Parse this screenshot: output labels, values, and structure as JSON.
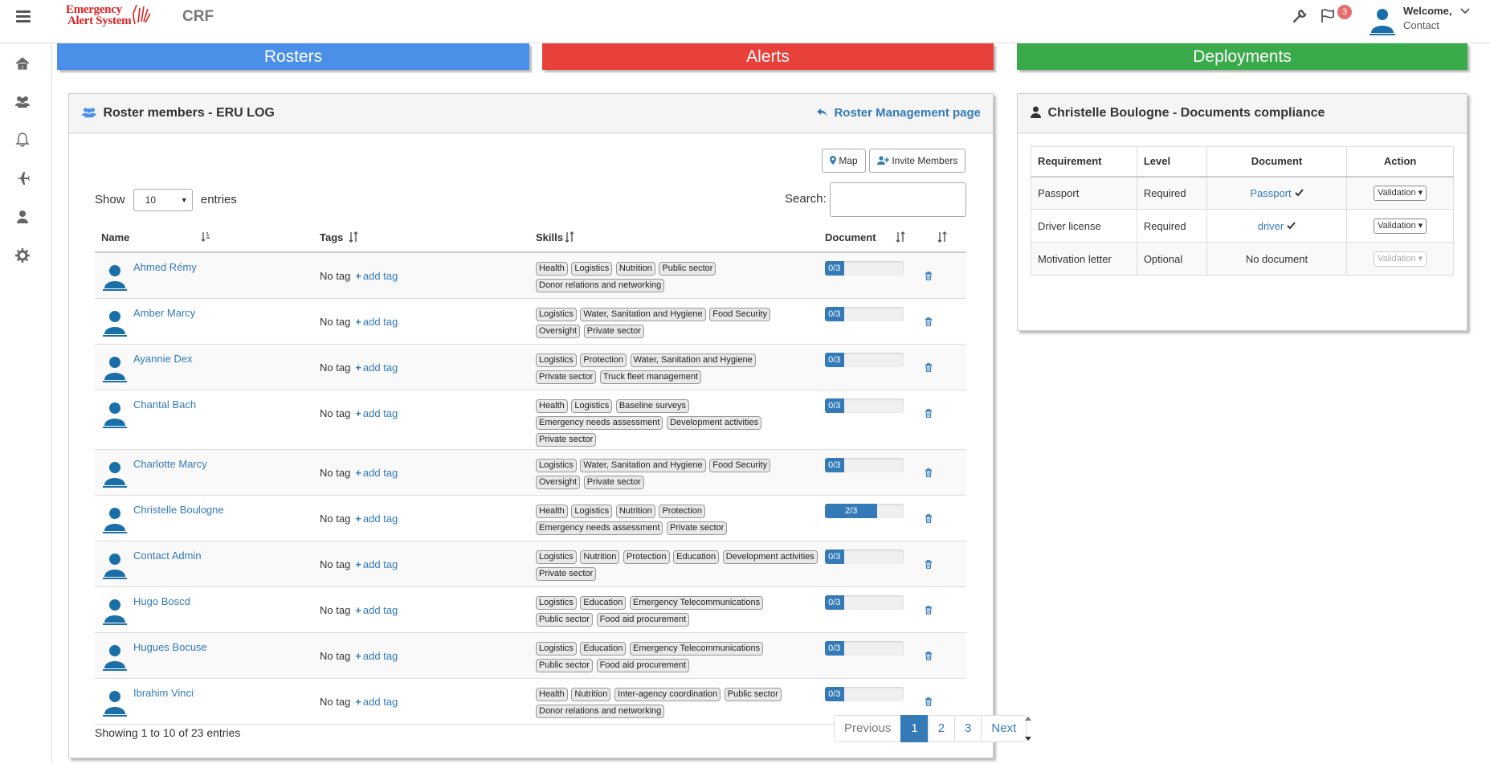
{
  "header": {
    "logo_line1": "Emergency",
    "logo_line2": "Alert System",
    "org": "CRF",
    "notification_count": "3",
    "welcome": "Welcome,",
    "user_name": "Contact"
  },
  "tabs": [
    "Rosters",
    "Alerts",
    "Deployments"
  ],
  "roster": {
    "title": "Roster members - ERU LOG",
    "management_link": "Roster Management page",
    "map_button": "Map",
    "invite_button": "Invite Members",
    "show_label": "Show",
    "entries_value": "10",
    "entries_label": "entries",
    "search_label": "Search:",
    "columns": [
      "Name",
      "Tags",
      "Skills",
      "Document",
      ""
    ],
    "no_tag": "No tag",
    "add_tag": "add tag",
    "members": [
      {
        "name": "Ahmed Rémy",
        "skills": [
          "Health",
          "Logistics",
          "Nutrition",
          "Public sector",
          "Donor relations and networking"
        ],
        "doc": "0/3",
        "doc_fraction": 0
      },
      {
        "name": "Amber Marcy",
        "skills": [
          "Logistics",
          "Water, Sanitation and Hygiene",
          "Food Security",
          "Oversight",
          "Private sector"
        ],
        "doc": "0/3",
        "doc_fraction": 0
      },
      {
        "name": "Ayannie Dex",
        "skills": [
          "Logistics",
          "Protection",
          "Water, Sanitation and Hygiene",
          "Private sector",
          "Truck fleet management"
        ],
        "doc": "0/3",
        "doc_fraction": 0
      },
      {
        "name": "Chantal Bach",
        "skills": [
          "Health",
          "Logistics",
          "Baseline surveys",
          "Emergency needs assessment",
          "Development activities",
          "Private sector"
        ],
        "doc": "0/3",
        "doc_fraction": 0
      },
      {
        "name": "Charlotte Marcy",
        "skills": [
          "Logistics",
          "Water, Sanitation and Hygiene",
          "Food Security",
          "Oversight",
          "Private sector"
        ],
        "doc": "0/3",
        "doc_fraction": 0
      },
      {
        "name": "Christelle Boulogne",
        "skills": [
          "Health",
          "Logistics",
          "Nutrition",
          "Protection",
          "Emergency needs assessment",
          "Private sector"
        ],
        "doc": "2/3",
        "doc_fraction": 0.667
      },
      {
        "name": "Contact Admin",
        "skills": [
          "Logistics",
          "Nutrition",
          "Protection",
          "Education",
          "Development activities",
          "Private sector"
        ],
        "doc": "0/3",
        "doc_fraction": 0
      },
      {
        "name": "Hugo Boscd",
        "skills": [
          "Logistics",
          "Education",
          "Emergency Telecommunications",
          "Public sector",
          "Food aid procurement"
        ],
        "doc": "0/3",
        "doc_fraction": 0
      },
      {
        "name": "Hugues Bocuse",
        "skills": [
          "Logistics",
          "Education",
          "Emergency Telecommunications",
          "Public sector",
          "Food aid procurement"
        ],
        "doc": "0/3",
        "doc_fraction": 0
      },
      {
        "name": "Ibrahim Vinci",
        "skills": [
          "Health",
          "Nutrition",
          "Inter-agency coordination",
          "Public sector",
          "Donor relations and networking"
        ],
        "doc": "0/3",
        "doc_fraction": 0
      }
    ],
    "info": "Showing 1 to 10 of 23 entries",
    "pagination": {
      "previous": "Previous",
      "pages": [
        "1",
        "2",
        "3"
      ],
      "active": "1",
      "next": "Next"
    }
  },
  "compliance": {
    "title": "Christelle Boulogne - Documents compliance",
    "columns": [
      "Requirement",
      "Level",
      "Document",
      "Action"
    ],
    "rows": [
      {
        "requirement": "Passport",
        "level": "Required",
        "document": "Passport",
        "linked": true,
        "action": "Validation",
        "enabled": true
      },
      {
        "requirement": "Driver license",
        "level": "Required",
        "document": "driver",
        "linked": true,
        "action": "Validation",
        "enabled": true
      },
      {
        "requirement": "Motivation letter",
        "level": "Optional",
        "document": "No document",
        "linked": false,
        "action": "Validation",
        "enabled": false
      }
    ]
  }
}
